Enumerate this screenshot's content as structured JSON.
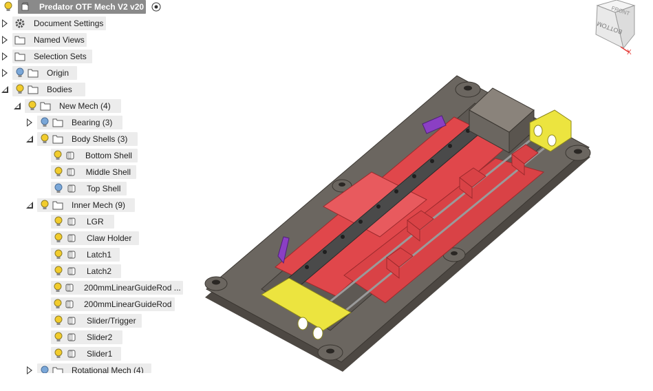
{
  "document": {
    "title": "Predator OTF Mech V2 v20"
  },
  "tree": [
    {
      "id": "document-settings",
      "label": "Document Settings",
      "icon": "gear-icon"
    },
    {
      "id": "named-views",
      "label": "Named Views"
    },
    {
      "id": "selection-sets",
      "label": "Selection Sets"
    },
    {
      "id": "origin",
      "label": "Origin"
    },
    {
      "id": "bodies",
      "label": "Bodies"
    },
    {
      "id": "new-mech",
      "label": "New Mech (4)"
    },
    {
      "id": "bearing",
      "label": "Bearing (3)"
    },
    {
      "id": "body-shells",
      "label": "Body Shells (3)"
    },
    {
      "id": "bottom-shell",
      "label": "Bottom Shell"
    },
    {
      "id": "middle-shell",
      "label": "Middle Shell"
    },
    {
      "id": "top-shell",
      "label": "Top Shell"
    },
    {
      "id": "inner-mech",
      "label": "Inner Mech (9)"
    },
    {
      "id": "lgr",
      "label": "LGR"
    },
    {
      "id": "claw-holder",
      "label": "Claw Holder"
    },
    {
      "id": "latch1",
      "label": "Latch1"
    },
    {
      "id": "latch2",
      "label": "Latch2"
    },
    {
      "id": "guide-rod-1",
      "label": "200mmLinearGuideRod ..."
    },
    {
      "id": "guide-rod-2",
      "label": "200mmLinearGuideRod"
    },
    {
      "id": "slider-trigger",
      "label": "Slider/Trigger"
    },
    {
      "id": "slider2",
      "label": "Slider2"
    },
    {
      "id": "slider1",
      "label": "Slider1"
    },
    {
      "id": "rotational-mech",
      "label": "Rotational Mech (4)"
    }
  ],
  "viewcube": {
    "top_face": "FRONT",
    "side_face": "BOTTOM",
    "axis_label": "X"
  },
  "colors": {
    "bulb_on": "#f2cc2c",
    "bulb_off": "#7aa7d8",
    "pill": "#ececec",
    "title_pill": "#8a8a8a",
    "base_gray": "#6b6660",
    "red_part": "#e0474b",
    "yellow_part": "#ece43f",
    "rail": "#4a4a4a",
    "purple_latch": "#8b3fc4",
    "axis_x": "#e53935"
  }
}
